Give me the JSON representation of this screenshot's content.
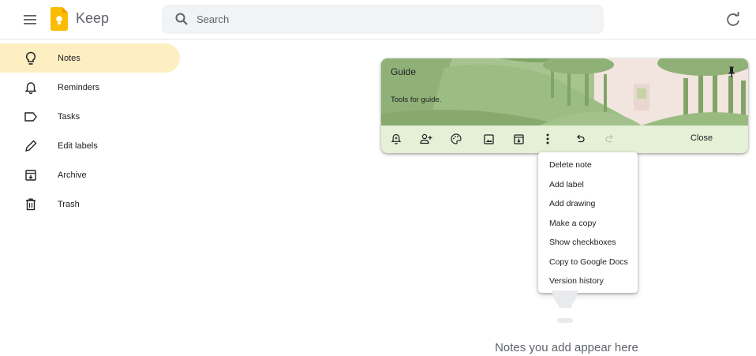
{
  "header": {
    "app_name": "Keep",
    "search_placeholder": "Search"
  },
  "sidebar": {
    "items": [
      {
        "label": "Notes",
        "icon": "lightbulb-icon",
        "active": true
      },
      {
        "label": "Reminders",
        "icon": "bell-icon",
        "active": false
      },
      {
        "label": "Tasks",
        "icon": "label-icon",
        "active": false
      },
      {
        "label": "Edit labels",
        "icon": "pencil-icon",
        "active": false
      },
      {
        "label": "Archive",
        "icon": "archive-icon",
        "active": false
      },
      {
        "label": "Trash",
        "icon": "trash-icon",
        "active": false
      }
    ]
  },
  "note": {
    "title": "Guide",
    "body": "Tools for guide.",
    "close_label": "Close",
    "toolbar_icons": [
      "reminder-icon",
      "collaborator-icon",
      "palette-icon",
      "image-icon",
      "archive-icon",
      "more-icon",
      "undo-icon",
      "redo-icon"
    ]
  },
  "more_menu": {
    "items": [
      "Delete note",
      "Add label",
      "Add drawing",
      "Make a copy",
      "Show checkboxes",
      "Copy to Google Docs",
      "Version history"
    ]
  },
  "empty_state": {
    "text": "Notes you add appear here"
  },
  "colors": {
    "active_nav": "#feefc3",
    "note_background": "#e6f4d7",
    "logo_yellow": "#fbbc04"
  }
}
